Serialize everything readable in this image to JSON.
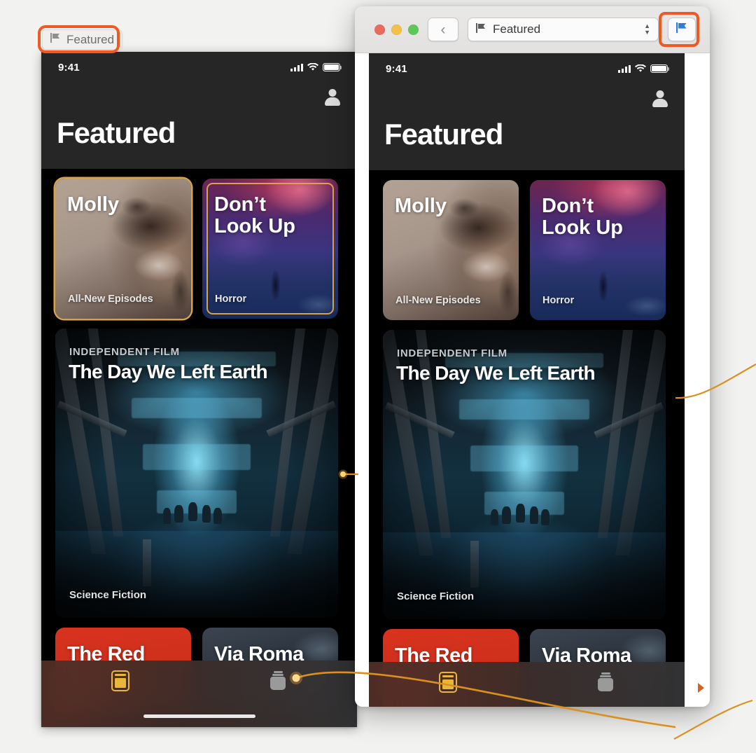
{
  "background_color": "#f2f2f0",
  "annotation": {
    "highlight_color": "#ef5a24",
    "line_color": "#d9901f",
    "dot_color": "#ffb638"
  },
  "featured_pill": {
    "label": "Featured",
    "icon": "flag-icon"
  },
  "mac_window": {
    "traffic_lights": [
      "close",
      "minimize",
      "zoom"
    ],
    "back_button_glyph": "‹",
    "popup_button": {
      "icon": "flag-icon",
      "value": "Featured",
      "options": [
        "Featured"
      ]
    },
    "flag_toolbar_button": {
      "icon": "flag-icon",
      "color": "#2f7ce0"
    }
  },
  "phone": {
    "status_bar": {
      "time": "9:41",
      "icons": [
        "cellular-signal-icon",
        "wifi-icon",
        "battery-icon"
      ]
    },
    "account_icon": "person-icon",
    "page_title": "Featured",
    "top_cards": [
      {
        "title": "Molly",
        "caption": "All-New Episodes",
        "art": "molly"
      },
      {
        "title": "Don’t\nLook Up",
        "caption": "Horror",
        "art": "dont-look-up"
      }
    ],
    "hero_card": {
      "eyebrow": "INDEPENDENT FILM",
      "title": "The Day We Left Earth",
      "caption": "Science Fiction"
    },
    "bottom_cards": [
      {
        "title": "The Red",
        "art": "red"
      },
      {
        "title": "Via Roma",
        "art": "roma"
      }
    ],
    "tab_bar": {
      "tabs": [
        {
          "name": "watch-now",
          "icon": "watch-now-icon",
          "selected": true
        },
        {
          "name": "store",
          "icon": "store-bag-icon",
          "selected": false
        }
      ]
    }
  }
}
